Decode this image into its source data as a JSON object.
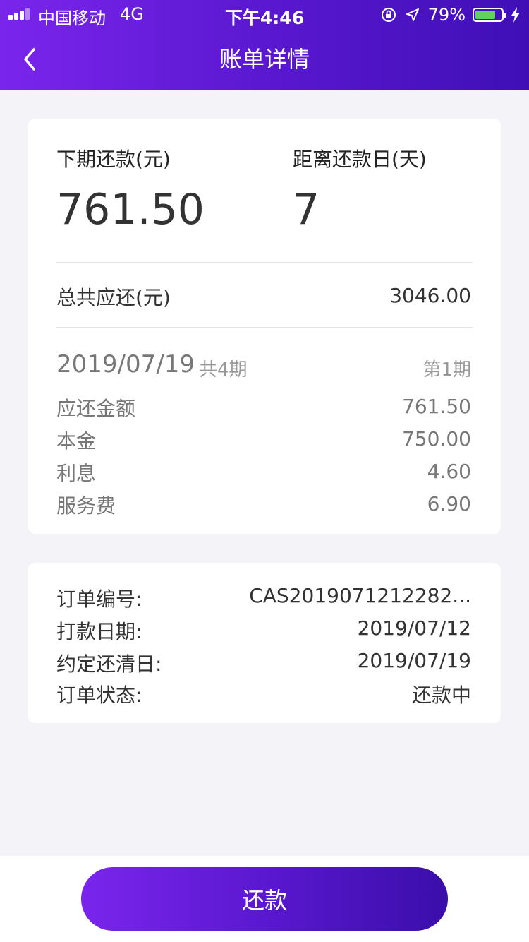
{
  "status_bar": {
    "carrier": "中国移动",
    "network": "4G",
    "time": "下午4:46",
    "battery_percent": "79%",
    "battery_level": 0.79,
    "icons": [
      "signal-icon",
      "orientation-lock-icon",
      "location-arrow-icon",
      "battery-icon",
      "charging-bolt-icon"
    ]
  },
  "nav": {
    "title": "账单详情",
    "back_icon": "chevron-left-icon"
  },
  "summary": {
    "next_payment_label": "下期还款(元)",
    "next_payment_value": "761.50",
    "days_left_label": "距离还款日(天)",
    "days_left_value": "7",
    "total_due_label": "总共应还(元)",
    "total_due_value": "3046.00"
  },
  "installment": {
    "date": "2019/07/19",
    "total_periods": "共4期",
    "current_period": "第1期",
    "rows": [
      {
        "label": "应还金额",
        "value": "761.50"
      },
      {
        "label": "本金",
        "value": "750.00"
      },
      {
        "label": "利息",
        "value": "4.60"
      },
      {
        "label": "服务费",
        "value": "6.90"
      }
    ]
  },
  "order": {
    "rows": [
      {
        "label": "订单编号:",
        "value": "CAS2019071212282..."
      },
      {
        "label": "打款日期:",
        "value": "2019/07/12"
      },
      {
        "label": "约定还清日:",
        "value": "2019/07/19"
      },
      {
        "label": "订单状态:",
        "value": "还款中"
      }
    ]
  },
  "actions": {
    "repay_label": "还款"
  },
  "colors": {
    "brand_start": "#7a25ec",
    "brand_end": "#3f0fb6",
    "page_background": "#f3f3f8",
    "card_background": "#ffffff",
    "battery_green": "#5fd35a"
  }
}
